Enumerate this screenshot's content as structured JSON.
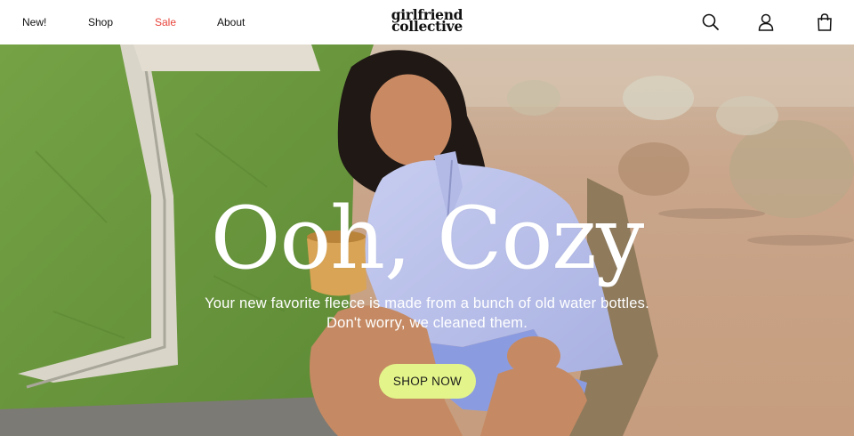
{
  "header": {
    "nav": [
      {
        "label": "New!"
      },
      {
        "label": "Shop"
      },
      {
        "label": "Sale"
      },
      {
        "label": "About"
      }
    ],
    "logo_line1": "girlfriend",
    "logo_line2": "collective",
    "icons": [
      "search-icon",
      "account-icon",
      "cart-icon"
    ]
  },
  "hero": {
    "headline": "Ooh, Cozy",
    "subtext": "Your new favorite fleece is made from a bunch of old water bottles. Don't worry, we cleaned them.",
    "cta_label": "SHOP NOW"
  },
  "colors": {
    "sale": "#e8433a",
    "cta_bg": "#e3f58a",
    "tent_green": "#6e9a3f",
    "desert": "#c9a586",
    "fleece": "#b8bfe8"
  }
}
